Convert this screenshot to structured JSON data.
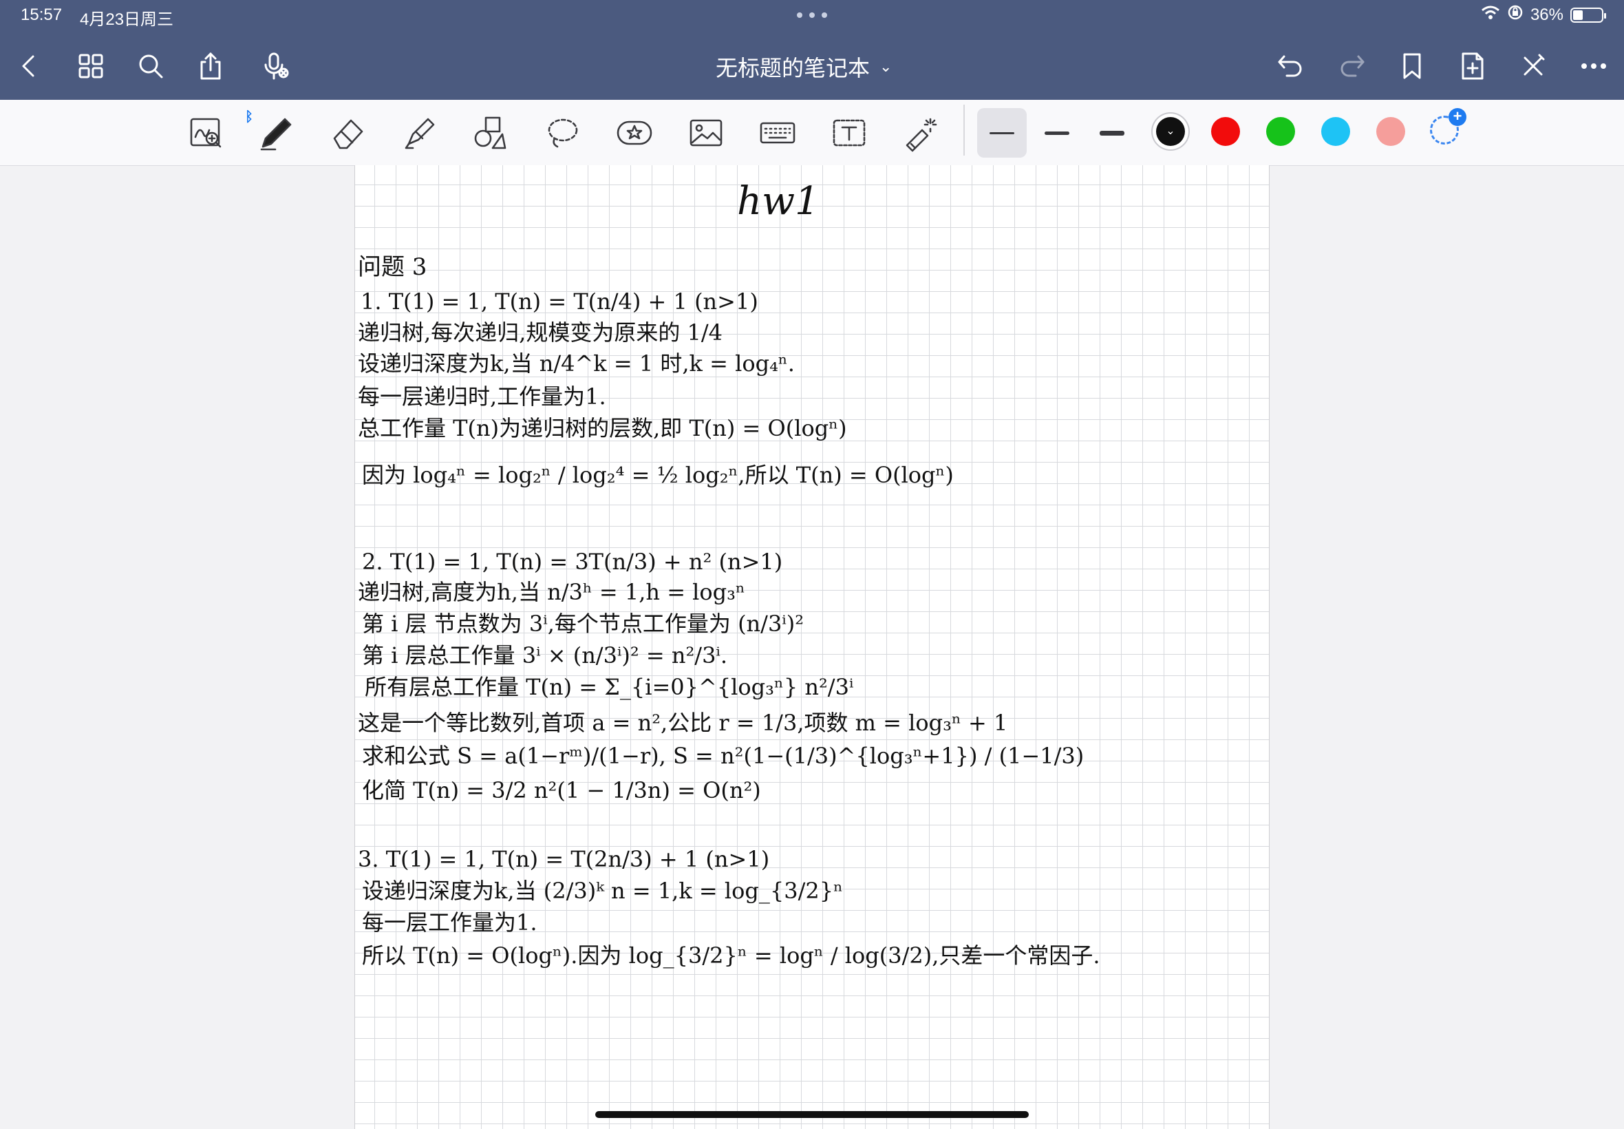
{
  "status_bar": {
    "time": "15:57",
    "date": "4月23日周三",
    "battery": "36%",
    "battery_level": 0.36
  },
  "nav": {
    "title": "无标题的笔记本",
    "title_chevron": "⌄",
    "left_icons": [
      "back-icon",
      "grid-icon",
      "search-icon",
      "share-icon",
      "microphone-icon"
    ],
    "right_icons": [
      "undo-icon",
      "redo-icon",
      "bookmark-icon",
      "add-page-icon",
      "close-icon",
      "more-icon"
    ]
  },
  "toolbar": {
    "tools": [
      "zoom-window-icon",
      "pen-icon",
      "eraser-icon",
      "highlighter-icon",
      "shapes-icon",
      "lasso-icon",
      "sticker-icon",
      "image-icon",
      "keyboard-icon",
      "text-box-icon",
      "laser-pointer-icon"
    ],
    "colors": [
      "#111111",
      "#f20c0c",
      "#16c21a",
      "#1ec3f5",
      "#f59e9b"
    ],
    "selected_color": "#111111"
  },
  "note": {
    "title": "hw1",
    "heading": "问题 3",
    "lines": [
      "1. T(1) = 1,  T(n) = T(n/4) + 1  (n>1)",
      "递归树,每次递归,规模变为原来的 1/4",
      "设递归深度为k,当 n/4^k = 1 时,k = log₄ⁿ.",
      "每一层递归时,工作量为1.",
      "总工作量 T(n)为递归树的层数,即 T(n) = O(logⁿ)",
      "因为 log₄ⁿ = log₂ⁿ / log₂⁴ = ½ log₂ⁿ,所以 T(n) = O(logⁿ)",
      "2. T(1) = 1,  T(n) = 3T(n/3) + n²  (n>1)",
      "递归树,高度为h,当 n/3ʰ = 1,h = log₃ⁿ",
      "第 i 层 节点数为 3ⁱ,每个节点工作量为 (n/3ⁱ)²",
      "第 i 层总工作量 3ⁱ × (n/3ⁱ)² = n²/3ⁱ.",
      "所有层总工作量 T(n) = Σ_{i=0}^{log₃ⁿ} n²/3ⁱ",
      "这是一个等比数列,首项 a = n²,公比 r = 1/3,项数 m = log₃ⁿ + 1",
      "求和公式 S = a(1−rᵐ)/(1−r),  S = n²(1−(1/3)^{log₃ⁿ+1}) / (1−1/3)",
      "化简 T(n) = 3/2 n²(1 − 1/3n) = O(n²)",
      "3. T(1) = 1,  T(n) = T(2n/3) + 1  (n>1)",
      "设递归深度为k,当 (2/3)ᵏ n = 1,k = log_{3/2}ⁿ",
      "每一层工作量为1.",
      "所以 T(n) = O(logⁿ).因为 log_{3/2}ⁿ = logⁿ / log(3/2),只差一个常因子."
    ]
  }
}
